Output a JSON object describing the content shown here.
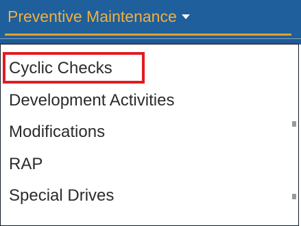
{
  "nav": {
    "menu_label": "Preventive Maintenance",
    "caret_icon": "caret-down-icon"
  },
  "dropdown": {
    "items": [
      {
        "label": "Cyclic Checks",
        "highlighted": true
      },
      {
        "label": "Development Activities",
        "highlighted": false
      },
      {
        "label": "Modifications",
        "highlighted": false
      },
      {
        "label": "RAP",
        "highlighted": false
      },
      {
        "label": "Special Drives",
        "highlighted": false
      }
    ]
  },
  "colors": {
    "nav_background": "#1f5f9c",
    "nav_text": "#f2b03a",
    "highlight_border": "#e01c22"
  }
}
